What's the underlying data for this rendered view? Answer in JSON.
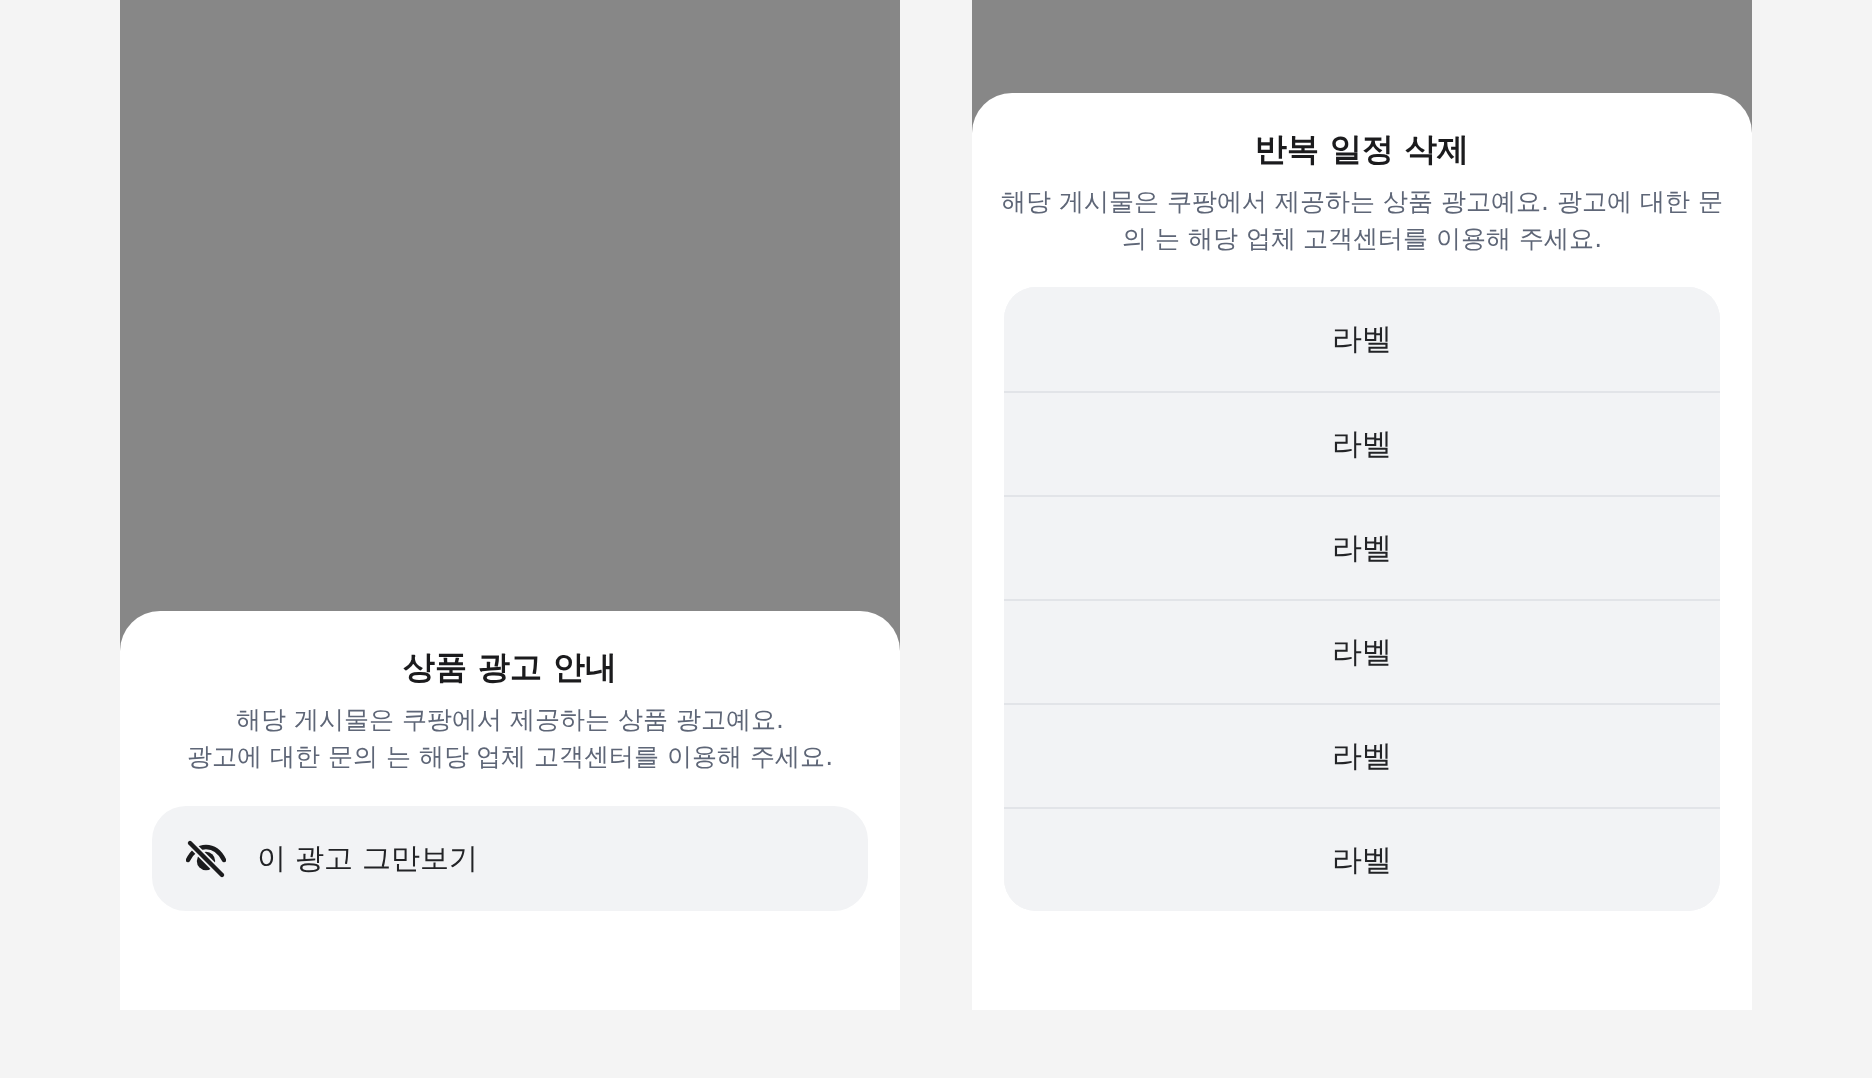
{
  "sheets": [
    {
      "kind": "action",
      "title": "상품 광고 안내",
      "description_lines": [
        "해당 게시물은 쿠팡에서 제공하는 상품 광고예요.",
        "광고에 대한 문의 는 해당 업체 고객센터를 이용해 주세요."
      ],
      "action": {
        "label": "이 광고 그만보기"
      }
    },
    {
      "kind": "options",
      "title": "반복 일정 삭제",
      "description_lines": [
        "해당 게시물은 쿠팡에서 제공하는 상품 광고예요. 광고에 대한 문",
        "의 는 해당 업체 고객센터를 이용해 주세요."
      ],
      "options": [
        "라벨",
        "라벨",
        "라벨",
        "라벨",
        "라벨",
        "라벨"
      ]
    }
  ]
}
